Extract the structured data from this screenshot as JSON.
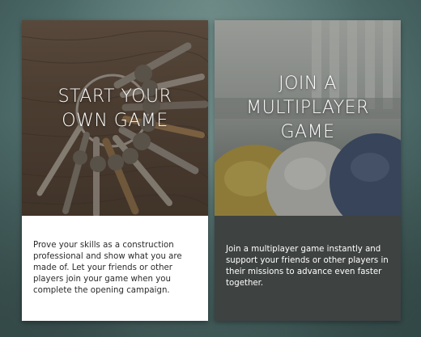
{
  "cards": [
    {
      "title_lines": [
        "START YOUR",
        "OWN GAME"
      ],
      "description": "Prove your skills as a construction professional and show what you are made of. Let your friends or other players join your game when you complete the opening campaign.",
      "image_icon": "keys-on-wood-image"
    },
    {
      "title_lines": [
        "JOIN A",
        "MULTIPLAYER",
        "GAME"
      ],
      "description": "Join a multiplayer game instantly and support your friends or other players in their missions to advance even faster together.",
      "image_icon": "hard-hats-image"
    }
  ],
  "colors": {
    "background": "#5f7c7a",
    "left_card_body": "#ffffff",
    "right_card_body": "#3e4241",
    "title_text": "#ffffff"
  }
}
